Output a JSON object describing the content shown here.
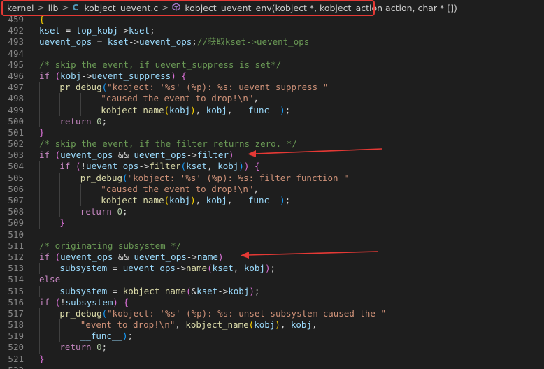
{
  "breadcrumb": {
    "items": [
      "kernel",
      "lib",
      "kobject_uevent.c",
      "kobject_uevent_env(kobject *, kobject_action action, char * [])"
    ],
    "separator": ">"
  },
  "colors": {
    "background": "#1e1e1e",
    "highlight_box": "#e53935",
    "arrow": "#e53935",
    "keyword": "#c586c0",
    "function": "#dcdcaa",
    "variable": "#9cdcfe",
    "string": "#ce9178",
    "comment": "#6a9955"
  },
  "icons": [
    "c-file-icon",
    "method-cube-icon",
    "chevron-right-icon",
    "red-arrow-icon"
  ],
  "code": {
    "lines": [
      {
        "n": "459",
        "indent": 0,
        "tokens": [
          [
            "br1",
            "{"
          ]
        ]
      },
      {
        "n": "492",
        "indent": 1,
        "tokens": [
          [
            "var",
            "kset"
          ],
          [
            "pun",
            " = "
          ],
          [
            "var",
            "top_kobj"
          ],
          [
            "pun",
            "->"
          ],
          [
            "var",
            "kset"
          ],
          [
            "pun",
            ";"
          ]
        ]
      },
      {
        "n": "493",
        "indent": 1,
        "tokens": [
          [
            "var",
            "uevent_ops"
          ],
          [
            "pun",
            " = "
          ],
          [
            "var",
            "kset"
          ],
          [
            "pun",
            "->"
          ],
          [
            "var",
            "uevent_ops"
          ],
          [
            "pun",
            ";"
          ],
          [
            "cmt",
            "//获取kset->uevent_ops"
          ]
        ]
      },
      {
        "n": "494",
        "indent": 0,
        "tokens": []
      },
      {
        "n": "495",
        "indent": 1,
        "tokens": [
          [
            "cmt",
            "/* skip the event, if uevent_suppress is set*/"
          ]
        ]
      },
      {
        "n": "496",
        "indent": 1,
        "tokens": [
          [
            "kw",
            "if"
          ],
          [
            "pun",
            " "
          ],
          [
            "br2",
            "("
          ],
          [
            "var",
            "kobj"
          ],
          [
            "pun",
            "->"
          ],
          [
            "var",
            "uevent_suppress"
          ],
          [
            "br2",
            ")"
          ],
          [
            "pun",
            " "
          ],
          [
            "br2",
            "{"
          ]
        ]
      },
      {
        "n": "497",
        "indent": 2,
        "tokens": [
          [
            "fn",
            "pr_debug"
          ],
          [
            "br3",
            "("
          ],
          [
            "str",
            "\"kobject: '%s' (%p): %s: uevent_suppress \""
          ]
        ]
      },
      {
        "n": "498",
        "indent": 4,
        "tokens": [
          [
            "str",
            "\"caused the event to drop!\\n\""
          ],
          [
            "pun",
            ","
          ]
        ]
      },
      {
        "n": "499",
        "indent": 4,
        "tokens": [
          [
            "fn",
            "kobject_name"
          ],
          [
            "br1",
            "("
          ],
          [
            "var",
            "kobj"
          ],
          [
            "br1",
            ")"
          ],
          [
            "pun",
            ", "
          ],
          [
            "var",
            "kobj"
          ],
          [
            "pun",
            ", "
          ],
          [
            "var",
            "__func__"
          ],
          [
            "br3",
            ")"
          ],
          [
            "pun",
            ";"
          ]
        ]
      },
      {
        "n": "500",
        "indent": 2,
        "tokens": [
          [
            "kw",
            "return"
          ],
          [
            "pun",
            " "
          ],
          [
            "num",
            "0"
          ],
          [
            "pun",
            ";"
          ]
        ]
      },
      {
        "n": "501",
        "indent": 1,
        "tokens": [
          [
            "br2",
            "}"
          ]
        ]
      },
      {
        "n": "502",
        "indent": 1,
        "tokens": [
          [
            "cmt",
            "/* skip the event, if the filter returns zero. */"
          ]
        ]
      },
      {
        "n": "503",
        "indent": 1,
        "tokens": [
          [
            "kw",
            "if"
          ],
          [
            "pun",
            " "
          ],
          [
            "br2",
            "("
          ],
          [
            "var",
            "uevent_ops"
          ],
          [
            "pun",
            " && "
          ],
          [
            "var",
            "uevent_ops"
          ],
          [
            "pun",
            "->"
          ],
          [
            "var",
            "filter"
          ],
          [
            "br2",
            ")"
          ]
        ]
      },
      {
        "n": "504",
        "indent": 2,
        "tokens": [
          [
            "kw",
            "if"
          ],
          [
            "pun",
            " "
          ],
          [
            "br2",
            "("
          ],
          [
            "pun",
            "!"
          ],
          [
            "var",
            "uevent_ops"
          ],
          [
            "pun",
            "->"
          ],
          [
            "fn",
            "filter"
          ],
          [
            "br3",
            "("
          ],
          [
            "var",
            "kset"
          ],
          [
            "pun",
            ", "
          ],
          [
            "var",
            "kobj"
          ],
          [
            "br3",
            ")"
          ],
          [
            "br2",
            ")"
          ],
          [
            "pun",
            " "
          ],
          [
            "br2",
            "{"
          ]
        ]
      },
      {
        "n": "505",
        "indent": 3,
        "tokens": [
          [
            "fn",
            "pr_debug"
          ],
          [
            "br3",
            "("
          ],
          [
            "str",
            "\"kobject: '%s' (%p): %s: filter function \""
          ]
        ]
      },
      {
        "n": "506",
        "indent": 4,
        "tokens": [
          [
            "str",
            "\"caused the event to drop!\\n\""
          ],
          [
            "pun",
            ","
          ]
        ]
      },
      {
        "n": "507",
        "indent": 4,
        "tokens": [
          [
            "fn",
            "kobject_name"
          ],
          [
            "br1",
            "("
          ],
          [
            "var",
            "kobj"
          ],
          [
            "br1",
            ")"
          ],
          [
            "pun",
            ", "
          ],
          [
            "var",
            "kobj"
          ],
          [
            "pun",
            ", "
          ],
          [
            "var",
            "__func__"
          ],
          [
            "br3",
            ")"
          ],
          [
            "pun",
            ";"
          ]
        ]
      },
      {
        "n": "508",
        "indent": 3,
        "tokens": [
          [
            "kw",
            "return"
          ],
          [
            "pun",
            " "
          ],
          [
            "num",
            "0"
          ],
          [
            "pun",
            ";"
          ]
        ]
      },
      {
        "n": "509",
        "indent": 2,
        "tokens": [
          [
            "br2",
            "}"
          ]
        ]
      },
      {
        "n": "510",
        "indent": 0,
        "tokens": []
      },
      {
        "n": "511",
        "indent": 1,
        "tokens": [
          [
            "cmt",
            "/* originating subsystem */"
          ]
        ]
      },
      {
        "n": "512",
        "indent": 1,
        "tokens": [
          [
            "kw",
            "if"
          ],
          [
            "pun",
            " "
          ],
          [
            "br2",
            "("
          ],
          [
            "var",
            "uevent_ops"
          ],
          [
            "pun",
            " && "
          ],
          [
            "var",
            "uevent_ops"
          ],
          [
            "pun",
            "->"
          ],
          [
            "var",
            "name"
          ],
          [
            "br2",
            ")"
          ]
        ]
      },
      {
        "n": "513",
        "indent": 2,
        "tokens": [
          [
            "var",
            "subsystem"
          ],
          [
            "pun",
            " = "
          ],
          [
            "var",
            "uevent_ops"
          ],
          [
            "pun",
            "->"
          ],
          [
            "fn",
            "name"
          ],
          [
            "br2",
            "("
          ],
          [
            "var",
            "kset"
          ],
          [
            "pun",
            ", "
          ],
          [
            "var",
            "kobj"
          ],
          [
            "br2",
            ")"
          ],
          [
            "pun",
            ";"
          ]
        ]
      },
      {
        "n": "514",
        "indent": 1,
        "tokens": [
          [
            "kw",
            "else"
          ]
        ]
      },
      {
        "n": "515",
        "indent": 2,
        "tokens": [
          [
            "var",
            "subsystem"
          ],
          [
            "pun",
            " = "
          ],
          [
            "fn",
            "kobject_name"
          ],
          [
            "br2",
            "("
          ],
          [
            "pun",
            "&"
          ],
          [
            "var",
            "kset"
          ],
          [
            "pun",
            "->"
          ],
          [
            "var",
            "kobj"
          ],
          [
            "br2",
            ")"
          ],
          [
            "pun",
            ";"
          ]
        ]
      },
      {
        "n": "516",
        "indent": 1,
        "tokens": [
          [
            "kw",
            "if"
          ],
          [
            "pun",
            " "
          ],
          [
            "br2",
            "("
          ],
          [
            "pun",
            "!"
          ],
          [
            "var",
            "subsystem"
          ],
          [
            "br2",
            ")"
          ],
          [
            "pun",
            " "
          ],
          [
            "br2",
            "{"
          ]
        ]
      },
      {
        "n": "517",
        "indent": 2,
        "tokens": [
          [
            "fn",
            "pr_debug"
          ],
          [
            "br3",
            "("
          ],
          [
            "str",
            "\"kobject: '%s' (%p): %s: unset subsystem caused the \""
          ]
        ]
      },
      {
        "n": "518",
        "indent": 3,
        "tokens": [
          [
            "str",
            "\"event to drop!\\n\""
          ],
          [
            "pun",
            ", "
          ],
          [
            "fn",
            "kobject_name"
          ],
          [
            "br1",
            "("
          ],
          [
            "var",
            "kobj"
          ],
          [
            "br1",
            ")"
          ],
          [
            "pun",
            ", "
          ],
          [
            "var",
            "kobj"
          ],
          [
            "pun",
            ","
          ]
        ]
      },
      {
        "n": "519",
        "indent": 3,
        "tokens": [
          [
            "var",
            "__func__"
          ],
          [
            "br3",
            ")"
          ],
          [
            "pun",
            ";"
          ]
        ]
      },
      {
        "n": "520",
        "indent": 2,
        "tokens": [
          [
            "kw",
            "return"
          ],
          [
            "pun",
            " "
          ],
          [
            "num",
            "0"
          ],
          [
            "pun",
            ";"
          ]
        ]
      },
      {
        "n": "521",
        "indent": 1,
        "tokens": [
          [
            "br2",
            "}"
          ]
        ]
      },
      {
        "n": "522",
        "indent": 0,
        "tokens": []
      }
    ]
  }
}
